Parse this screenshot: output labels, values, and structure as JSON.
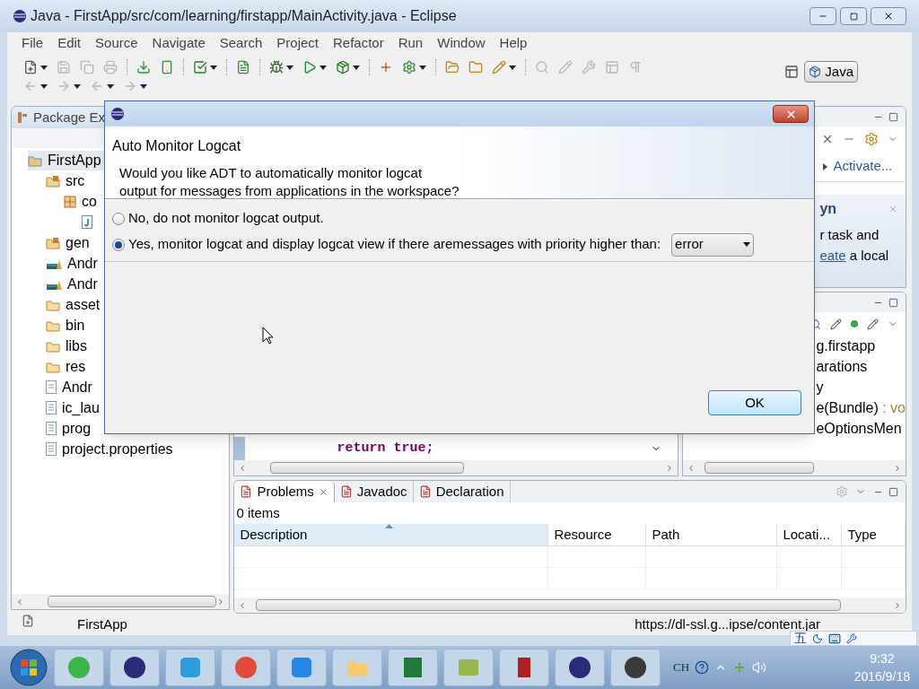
{
  "window": {
    "title": "Java - FirstApp/src/com/learning/firstapp/MainActivity.java - Eclipse"
  },
  "menu": [
    "File",
    "Edit",
    "Source",
    "Navigate",
    "Search",
    "Project",
    "Refactor",
    "Run",
    "Window",
    "Help"
  ],
  "perspective": {
    "label": "Java",
    "selected": true
  },
  "package_explorer": {
    "title": "Package Ex",
    "items": [
      {
        "label": "FirstApp",
        "kind": "project",
        "selected": true,
        "children": [
          {
            "label": "src",
            "kind": "source-folder",
            "selected": false,
            "children": [
              {
                "label": "co",
                "kind": "package",
                "selected": false,
                "children": [
                  {
                    "kind": "java-file",
                    "selected": false
                  }
                ]
              }
            ]
          },
          {
            "label": "gen",
            "kind": "source-folder",
            "selected": false
          },
          {
            "label": "Andr",
            "kind": "library",
            "selected": false
          },
          {
            "label": "Andr",
            "kind": "library",
            "selected": false
          },
          {
            "label": "asset",
            "kind": "folder",
            "selected": false
          },
          {
            "label": "bin",
            "kind": "folder",
            "selected": false
          },
          {
            "label": "libs",
            "kind": "folder",
            "selected": false
          },
          {
            "label": "res",
            "kind": "folder",
            "selected": false
          },
          {
            "label": "Andr",
            "kind": "manifest",
            "selected": false
          },
          {
            "label": "ic_lau",
            "kind": "file",
            "selected": false
          },
          {
            "label": "prog",
            "kind": "file",
            "selected": false
          },
          {
            "label": "project.properties",
            "kind": "file",
            "selected": false
          }
        ]
      }
    ]
  },
  "editor": {
    "code": "return true;"
  },
  "task_panel": {
    "link": "Activate...",
    "mylyn_title": "yn",
    "mylyn_text": "r task and",
    "mylyn_link": "eate",
    "mylyn_text_after": "a local"
  },
  "outline": {
    "items": [
      {
        "label": "g.firstapp"
      },
      {
        "label": "arations"
      },
      {
        "label": "y"
      },
      {
        "label": "e(Bundle)",
        "type": " : vo"
      },
      {
        "label": "eOptionsMen"
      }
    ]
  },
  "problems": {
    "tabs": [
      {
        "label": "Problems",
        "selected": true,
        "closable": true
      },
      {
        "label": "Javadoc",
        "selected": false,
        "closable": false
      },
      {
        "label": "Declaration",
        "selected": false,
        "closable": false
      }
    ],
    "summary": "0 items",
    "columns": [
      {
        "label": "Description",
        "sorted": true
      },
      {
        "label": "Resource",
        "sorted": false
      },
      {
        "label": "Path",
        "sorted": false
      },
      {
        "label": "Locati...",
        "sorted": false
      },
      {
        "label": "Type",
        "sorted": false
      }
    ]
  },
  "status_bar": {
    "project": "FirstApp",
    "url": "https://dl-ssl.g...ipse/content.jar"
  },
  "dialog": {
    "heading": "Auto Monitor Logcat",
    "message": "Would you like ADT to automatically monitor logcat\noutput for messages from applications in the workspace?",
    "options": [
      {
        "label": "No, do not monitor logcat output.",
        "selected": false
      },
      {
        "label": "Yes, monitor logcat and display logcat view if there aremessages with priority higher than:",
        "selected": true
      }
    ],
    "priority": "error",
    "ok": "OK"
  },
  "ime_bar": {
    "mode": "五"
  },
  "taskbar": {
    "input_lang": "CH",
    "time": "9:32",
    "date": "2016/9/18"
  }
}
